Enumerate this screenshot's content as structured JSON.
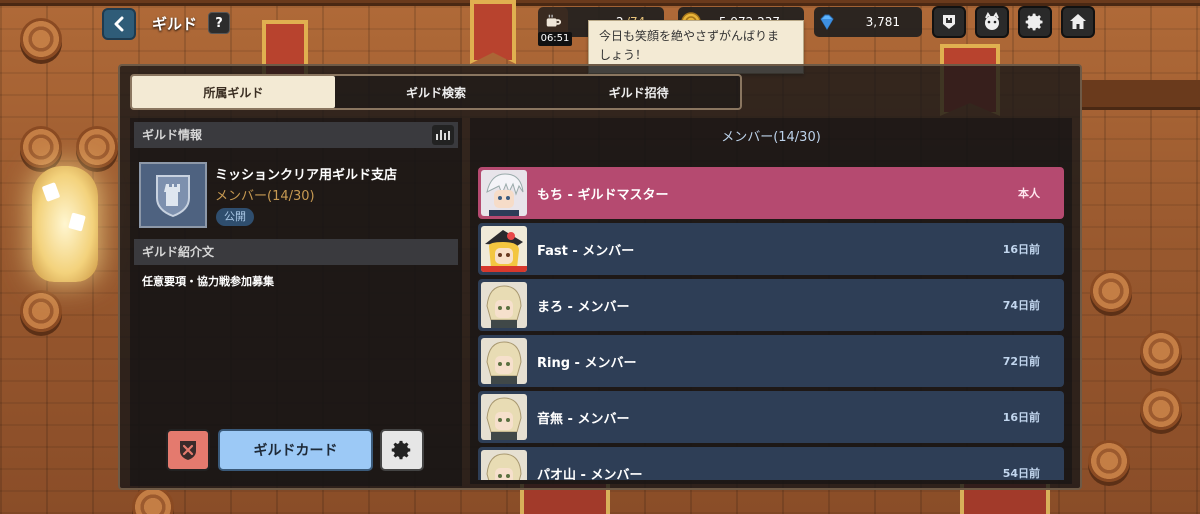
{
  "hud": {
    "title": "ギルド",
    "help": "?",
    "stamina": {
      "current": "2",
      "max": "/74",
      "timer": "06:51"
    },
    "gold": "5,972,237",
    "gems": "3,781"
  },
  "speech_bubble": {
    "line1": "今日も笑顔を絶やさずがんばりま",
    "line2": "しょう！"
  },
  "tabs": [
    {
      "label": "所属ギルド",
      "active": true
    },
    {
      "label": "ギルド検索",
      "active": false
    },
    {
      "label": "ギルド招待",
      "active": false
    }
  ],
  "guild_info": {
    "section_title": "ギルド情報",
    "name": "ミッションクリア用ギルド支店",
    "members": "メンバー(14/30)",
    "visibility": "公開",
    "intro_title": "ギルド紹介文",
    "intro_text": "任意要項・協力戦参加募集"
  },
  "buttons": {
    "guild_card": "ギルドカード"
  },
  "members": {
    "header": "メンバー(14/30)",
    "rows": [
      {
        "name": "もち",
        "role": " - ギルドマスター",
        "last": "本人",
        "master": true
      },
      {
        "name": "Fast",
        "role": " - メンバー",
        "last": "16日前",
        "master": false
      },
      {
        "name": "まろ",
        "role": " - メンバー",
        "last": "74日前",
        "master": false
      },
      {
        "name": "Ring",
        "role": " - メンバー",
        "last": "72日前",
        "master": false
      },
      {
        "name": "音無",
        "role": " - メンバー",
        "last": "16日前",
        "master": false
      },
      {
        "name": "パオ山",
        "role": " - メンバー",
        "last": "54日前",
        "master": false
      }
    ]
  },
  "colors": {
    "master_row": "#b54a70",
    "member_row": "#2e3e56",
    "accent_gold": "#c79a52",
    "guild_card_button": "#9cc9f6"
  }
}
